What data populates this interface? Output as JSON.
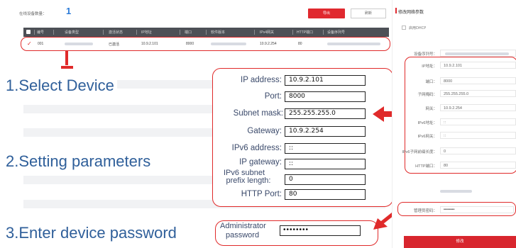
{
  "toolbar": {
    "online_label": "在线设备数量：",
    "online_count": "1",
    "export_label": "导出",
    "refresh_label": "刷新"
  },
  "table": {
    "headers": [
      "编号",
      "设备类型",
      "激活状态",
      "IP地址",
      "端口",
      "软件版本",
      "IPv4网关",
      "HTTP端口",
      "设备序列号"
    ],
    "row": {
      "index": "001",
      "status": "已激活",
      "ip": "10.9.2.101",
      "port": "8000",
      "gateway": "10.9.2.254",
      "http_port": "80"
    }
  },
  "steps": {
    "step1": "1.Select Device",
    "step2": "2.Setting parameters",
    "step3": "3.Enter device password"
  },
  "form": {
    "ip_label": "IP address:",
    "ip_value": "10.9.2.101",
    "port_label": "Port:",
    "port_value": "8000",
    "mask_label": "Subnet mask:",
    "mask_value": "255.255.255.0",
    "gateway_label": "Gateway:",
    "gateway_value": "10.9.2.254",
    "ipv6_label": "IPv6 address:",
    "ipv6_value": "::",
    "ipv6_gw_label": "IP gateway:",
    "ipv6_gw_value": "::",
    "ipv6_prefix_label_1": "IPv6 subnet",
    "ipv6_prefix_label_2": "prefix length:",
    "ipv6_prefix_value": "0",
    "http_label": "HTTP Port:",
    "http_value": "80",
    "admin_label_1": "Administrator",
    "admin_label_2": "password",
    "admin_value": "••••••••"
  },
  "right_panel": {
    "title": "修改网络参数",
    "dhcp_label": "启用DHCP",
    "serial_label": "设备序列号：",
    "ip_label": "IP地址：",
    "ip_value": "10.9.2.101",
    "port_label": "端口：",
    "port_value": "8000",
    "mask_label": "子网掩码：",
    "mask_value": "255.255.255.0",
    "gateway_label": "网关：",
    "gateway_value": "10.9.2.254",
    "ipv6_label": "IPv6地址：",
    "ipv6_value": "::",
    "ipv6_gw_label": "IPv6网关：",
    "ipv6_gw_value": "::",
    "ipv6_prefix_label": "IPv6子网前缀长度：",
    "ipv6_prefix_value": "0",
    "http_label": "HTTP端口：",
    "http_value": "80",
    "pwd_label": "管理员密码：",
    "pwd_value": "••••••••",
    "save_label": "修改"
  },
  "colors": {
    "accent_red": "#e02a2a",
    "step_blue": "#2f5f9a",
    "table_header": "#4d5056"
  }
}
